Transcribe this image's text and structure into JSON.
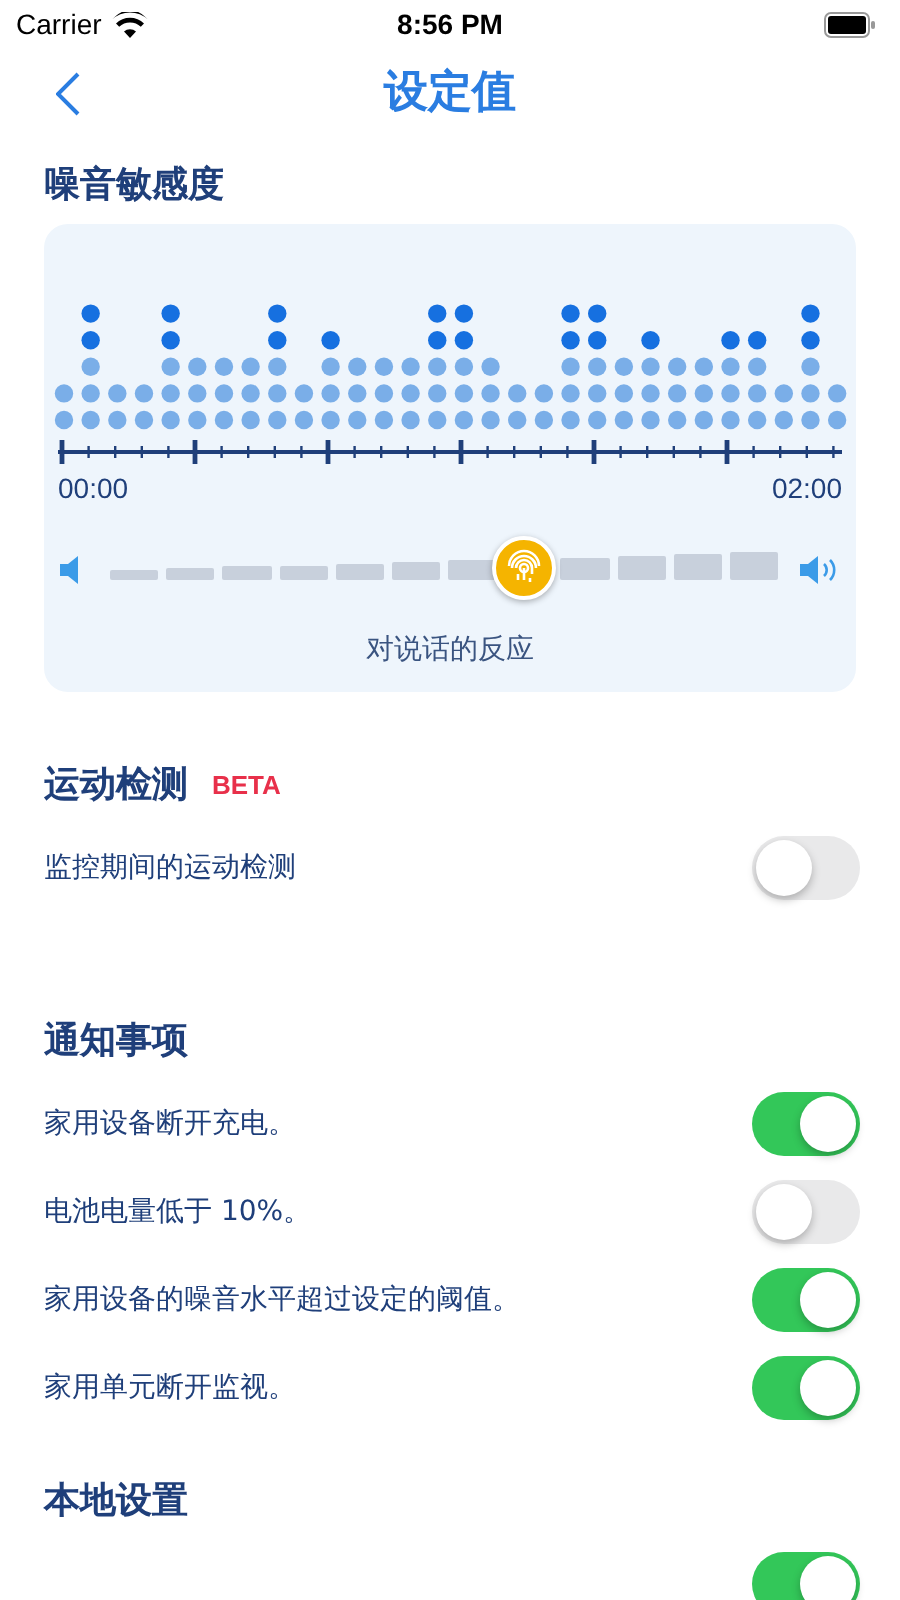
{
  "status_bar": {
    "carrier": "Carrier",
    "time": "8:56 PM"
  },
  "nav": {
    "title": "设定值"
  },
  "noise": {
    "heading": "噪音敏感度",
    "start_time": "00:00",
    "end_time": "02:00",
    "level": 0.62,
    "caption": "对说话的反应"
  },
  "motion": {
    "heading": "运动检测",
    "badge": "BETA",
    "rows": [
      {
        "label": "监控期间的运动检测",
        "on": false
      }
    ]
  },
  "notifications": {
    "heading": "通知事项",
    "rows": [
      {
        "label": "家用设备断开充电。",
        "on": true
      },
      {
        "label": "电池电量低于 10%。",
        "on": false
      },
      {
        "label": "家用设备的噪音水平超过设定的阈值。",
        "on": true
      },
      {
        "label": "家用单元断开监视。",
        "on": true
      }
    ]
  },
  "local": {
    "heading": "本地设置",
    "rows": [
      {
        "on": true
      }
    ]
  }
}
